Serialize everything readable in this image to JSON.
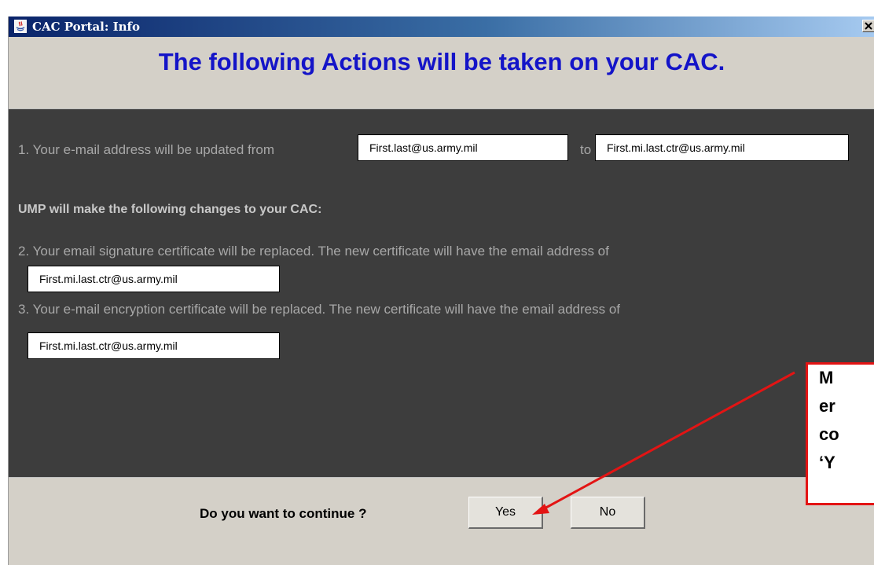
{
  "window": {
    "title": "CAC Portal: Info",
    "close_symbol": "×"
  },
  "heading": "The following Actions will be taken on your CAC.",
  "panel": {
    "line1_prefix": "1. Your e-mail address will be updated from",
    "old_email": "First.last@us.army.mil",
    "line1_to": "to",
    "new_email": "First.mi.last.ctr@us.army.mil",
    "ump_heading": "UMP will make the following changes to your CAC:",
    "line2": "2. Your email signature certificate will be replaced.  The new certificate will have the email address of",
    "signature_email": "First.mi.last.ctr@us.army.mil",
    "line3": "3. Your e-mail encryption certificate will be replaced.  The new certificate will have the email address of",
    "encryption_email": "First.mi.last.ctr@us.army.mil"
  },
  "footer": {
    "question": "Do you want to continue ?",
    "yes_label": "Yes",
    "no_label": "No"
  },
  "callout": {
    "lines": [
      "M",
      "er",
      "co",
      "‘Y"
    ],
    "border_color": "#e31414"
  },
  "colors": {
    "heading": "#1414c8",
    "panel_bg": "#3d3d3d",
    "dialog_bg": "#d4d0c8",
    "title_bar": "#0a246a",
    "arrow": "#e31414"
  }
}
